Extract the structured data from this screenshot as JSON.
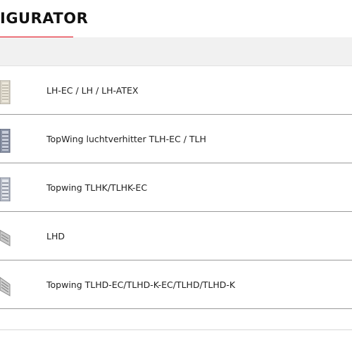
{
  "page": {
    "title": "IGURATOR"
  },
  "products": [
    {
      "label": "LH-EC / LH / LH-ATEX",
      "thumb_icon": "unit-heater-thumbnail-icon"
    },
    {
      "label": "TopWing luchtverhitter TLH-EC / TLH",
      "thumb_icon": "topwing-heater-thumbnail-icon"
    },
    {
      "label": "Topwing TLHK/TLHK-EC",
      "thumb_icon": "topwing-cooler-thumbnail-icon"
    },
    {
      "label": "LHD",
      "thumb_icon": "ceiling-unit-thumbnail-icon"
    },
    {
      "label": "Topwing TLHD-EC/TLHD-K-EC/TLHD/TLHD-K",
      "thumb_icon": "topwing-ceiling-unit-thumbnail-icon"
    }
  ],
  "colors": {
    "accent": "#e3000f",
    "header_bar": "#f1f1f1",
    "divider": "#9a9a9a"
  }
}
